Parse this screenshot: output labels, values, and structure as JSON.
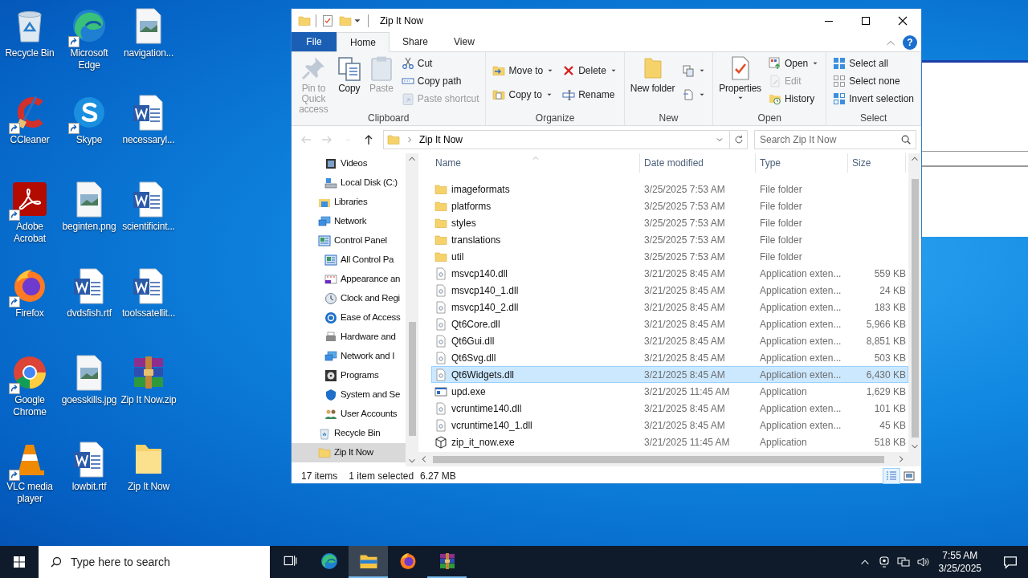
{
  "window": {
    "title": "Zip It Now"
  },
  "desktop_icons": [
    {
      "label": "Recycle Bin",
      "kind": "recycle",
      "shortcut": false
    },
    {
      "label": "Microsoft Edge",
      "kind": "edge",
      "shortcut": true
    },
    {
      "label": "navigation...",
      "kind": "image",
      "shortcut": false
    },
    {
      "label": "CCleaner",
      "kind": "ccleaner",
      "shortcut": true
    },
    {
      "label": "Skype",
      "kind": "skype",
      "shortcut": true
    },
    {
      "label": "necessaryl...",
      "kind": "word",
      "shortcut": false
    },
    {
      "label": "Adobe Acrobat",
      "kind": "acrobat",
      "shortcut": true
    },
    {
      "label": "beginten.png",
      "kind": "image",
      "shortcut": false
    },
    {
      "label": "scientificint...",
      "kind": "word",
      "shortcut": false
    },
    {
      "label": "Firefox",
      "kind": "firefox",
      "shortcut": true
    },
    {
      "label": "dvdsfish.rtf",
      "kind": "word",
      "shortcut": false
    },
    {
      "label": "toolssatellit...",
      "kind": "word",
      "shortcut": false
    },
    {
      "label": "Google Chrome",
      "kind": "chrome",
      "shortcut": true
    },
    {
      "label": "goesskills.jpg",
      "kind": "image",
      "shortcut": false
    },
    {
      "label": "Zip It Now.zip",
      "kind": "archive",
      "shortcut": false
    },
    {
      "label": "VLC media player",
      "kind": "vlc",
      "shortcut": true
    },
    {
      "label": "lowbit.rtf",
      "kind": "word",
      "shortcut": false
    },
    {
      "label": "Zip It Now",
      "kind": "folder",
      "shortcut": false
    }
  ],
  "ribbon": {
    "tabs": [
      {
        "label": "File",
        "kind": "file",
        "selected": false
      },
      {
        "label": "Home",
        "kind": "tab",
        "selected": true
      },
      {
        "label": "Share",
        "kind": "tab",
        "selected": false
      },
      {
        "label": "View",
        "kind": "tab",
        "selected": false
      }
    ],
    "help": "?",
    "groups": [
      {
        "label": "Clipboard",
        "columns": [
          {
            "kind": "large",
            "items": [
              {
                "label": "Pin to Quick access",
                "kind": "pin",
                "disabled": true,
                "dropdown": false
              }
            ]
          },
          {
            "kind": "large",
            "items": [
              {
                "label": "Copy",
                "kind": "copy",
                "disabled": false,
                "dropdown": false
              }
            ]
          },
          {
            "kind": "large",
            "items": [
              {
                "label": "Paste",
                "kind": "paste",
                "disabled": true,
                "dropdown": false
              }
            ]
          },
          {
            "kind": "small",
            "items": [
              {
                "label": "Cut",
                "kind": "cut",
                "disabled": false,
                "dropdown": false
              },
              {
                "label": "Copy path",
                "kind": "copypath",
                "disabled": false,
                "dropdown": false
              },
              {
                "label": "Paste shortcut",
                "kind": "pasteshortcut",
                "disabled": true,
                "dropdown": false
              }
            ]
          }
        ]
      },
      {
        "label": "Organize",
        "columns": [
          {
            "kind": "small",
            "items": [
              {
                "label": "Move to",
                "kind": "moveto",
                "disabled": false,
                "dropdown": true
              },
              {
                "label": "Copy to",
                "kind": "copyto",
                "disabled": false,
                "dropdown": true
              }
            ]
          },
          {
            "kind": "small",
            "items": [
              {
                "label": "Delete",
                "kind": "delete",
                "disabled": false,
                "dropdown": true
              },
              {
                "label": "Rename",
                "kind": "rename",
                "disabled": false,
                "dropdown": false
              }
            ]
          }
        ]
      },
      {
        "label": "New",
        "columns": [
          {
            "kind": "large",
            "items": [
              {
                "label": "New folder",
                "kind": "newfolder",
                "disabled": false,
                "dropdown": false
              }
            ]
          },
          {
            "kind": "small",
            "items": [
              {
                "kind": "newitem",
                "disabled": false,
                "dropdown": true
              },
              {
                "kind": "easyaccess",
                "disabled": false,
                "dropdown": true
              }
            ]
          }
        ]
      },
      {
        "label": "Open",
        "columns": [
          {
            "kind": "large",
            "items": [
              {
                "label": "Properties",
                "kind": "properties",
                "disabled": false,
                "dropdown": true
              }
            ]
          },
          {
            "kind": "small",
            "items": [
              {
                "label": "Open",
                "kind": "open",
                "disabled": false,
                "dropdown": true
              },
              {
                "label": "Edit",
                "kind": "edit",
                "disabled": true,
                "dropdown": false
              },
              {
                "label": "History",
                "kind": "history",
                "disabled": false,
                "dropdown": false
              }
            ]
          }
        ]
      },
      {
        "label": "Select",
        "columns": [
          {
            "kind": "small",
            "items": [
              {
                "label": "Select all",
                "kind": "selectall",
                "disabled": false,
                "dropdown": false
              },
              {
                "label": "Select none",
                "kind": "selectnone",
                "disabled": false,
                "dropdown": false
              },
              {
                "label": "Invert selection",
                "kind": "invert",
                "disabled": false,
                "dropdown": false
              }
            ]
          }
        ]
      }
    ]
  },
  "nav_buttons": [
    {
      "kind": "back",
      "disabled": true
    },
    {
      "kind": "forward",
      "disabled": true
    },
    {
      "kind": "recent",
      "disabled": true
    },
    {
      "kind": "up",
      "disabled": false
    }
  ],
  "address": {
    "path": "Zip It Now"
  },
  "search": {
    "placeholder": "Search Zip It Now"
  },
  "nav_pane": {
    "continued_children": [
      {
        "label": "Videos",
        "kind": "videos",
        "selected": false
      },
      {
        "label": "Local Disk (C:)",
        "kind": "disk",
        "selected": false
      }
    ],
    "items": [
      {
        "label": "Libraries",
        "kind": "libraries",
        "selected": false
      },
      {
        "label": "Network",
        "kind": "network",
        "selected": false
      },
      {
        "label": "Control Panel",
        "kind": "controlpanel",
        "selected": false,
        "children": [
          {
            "label": "All Control Pa",
            "kind": "controlpanel",
            "selected": false
          },
          {
            "label": "Appearance an",
            "kind": "appearance",
            "selected": false
          },
          {
            "label": "Clock and Regi",
            "kind": "clock",
            "selected": false
          },
          {
            "label": "Ease of Access",
            "kind": "ease",
            "selected": false
          },
          {
            "label": "Hardware and",
            "kind": "hardware",
            "selected": false
          },
          {
            "label": "Network and I",
            "kind": "network",
            "selected": false
          },
          {
            "label": "Programs",
            "kind": "programs",
            "selected": false
          },
          {
            "label": "System and Se",
            "kind": "system",
            "selected": false
          },
          {
            "label": "User Accounts",
            "kind": "users",
            "selected": false
          }
        ]
      },
      {
        "label": "Recycle Bin",
        "kind": "recycle",
        "selected": false
      },
      {
        "label": "Zip It Now",
        "kind": "folder",
        "selected": true
      }
    ]
  },
  "file_list": {
    "columns": [
      {
        "label": "Name",
        "sorted": true
      },
      {
        "label": "Date modified",
        "sorted": false
      },
      {
        "label": "Type",
        "sorted": false
      },
      {
        "label": "Size",
        "sorted": false
      }
    ],
    "rows": [
      {
        "name": "imageformats",
        "date": "3/25/2025 7:53 AM",
        "type": "File folder",
        "kind": "folder",
        "selected": false
      },
      {
        "name": "platforms",
        "date": "3/25/2025 7:53 AM",
        "type": "File folder",
        "kind": "folder",
        "selected": false
      },
      {
        "name": "styles",
        "date": "3/25/2025 7:53 AM",
        "type": "File folder",
        "kind": "folder",
        "selected": false
      },
      {
        "name": "translations",
        "date": "3/25/2025 7:53 AM",
        "type": "File folder",
        "kind": "folder",
        "selected": false
      },
      {
        "name": "util",
        "date": "3/25/2025 7:53 AM",
        "type": "File folder",
        "kind": "folder",
        "selected": false
      },
      {
        "name": "msvcp140.dll",
        "date": "3/21/2025 8:45 AM",
        "type": "Application exten...",
        "size": "559 KB",
        "kind": "dll",
        "selected": false
      },
      {
        "name": "msvcp140_1.dll",
        "date": "3/21/2025 8:45 AM",
        "type": "Application exten...",
        "size": "24 KB",
        "kind": "dll",
        "selected": false
      },
      {
        "name": "msvcp140_2.dll",
        "date": "3/21/2025 8:45 AM",
        "type": "Application exten...",
        "size": "183 KB",
        "kind": "dll",
        "selected": false
      },
      {
        "name": "Qt6Core.dll",
        "date": "3/21/2025 8:45 AM",
        "type": "Application exten...",
        "size": "5,966 KB",
        "kind": "dll",
        "selected": false
      },
      {
        "name": "Qt6Gui.dll",
        "date": "3/21/2025 8:45 AM",
        "type": "Application exten...",
        "size": "8,851 KB",
        "kind": "dll",
        "selected": false
      },
      {
        "name": "Qt6Svg.dll",
        "date": "3/21/2025 8:45 AM",
        "type": "Application exten...",
        "size": "503 KB",
        "kind": "dll",
        "selected": false
      },
      {
        "name": "Qt6Widgets.dll",
        "date": "3/21/2025 8:45 AM",
        "type": "Application exten...",
        "size": "6,430 KB",
        "kind": "dll",
        "selected": true
      },
      {
        "name": "upd.exe",
        "date": "3/21/2025 11:45 AM",
        "type": "Application",
        "size": "1,629 KB",
        "kind": "exe",
        "selected": false
      },
      {
        "name": "vcruntime140.dll",
        "date": "3/21/2025 8:45 AM",
        "type": "Application exten...",
        "size": "101 KB",
        "kind": "dll",
        "selected": false
      },
      {
        "name": "vcruntime140_1.dll",
        "date": "3/21/2025 8:45 AM",
        "type": "Application exten...",
        "size": "45 KB",
        "kind": "dll",
        "selected": false
      },
      {
        "name": "zip_it_now.exe",
        "date": "3/21/2025 11:45 AM",
        "type": "Application",
        "size": "518 KB",
        "kind": "package",
        "selected": false
      }
    ]
  },
  "status_bar": {
    "item_count": "17 items",
    "selection": "1 item selected",
    "selection_size": "6.27 MB",
    "view_buttons": [
      {
        "kind": "details",
        "selected": true
      },
      {
        "kind": "largeicons",
        "selected": false
      }
    ]
  },
  "taskbar": {
    "search_placeholder": "Type here to search",
    "apps": [
      {
        "kind": "edge",
        "active": false,
        "running": false
      },
      {
        "kind": "explorer",
        "active": true,
        "running": true
      },
      {
        "kind": "firefox",
        "active": false,
        "running": false
      },
      {
        "kind": "archive",
        "active": false,
        "running": true
      }
    ],
    "clock": {
      "time": "7:55 AM",
      "date": "3/25/2025"
    }
  }
}
